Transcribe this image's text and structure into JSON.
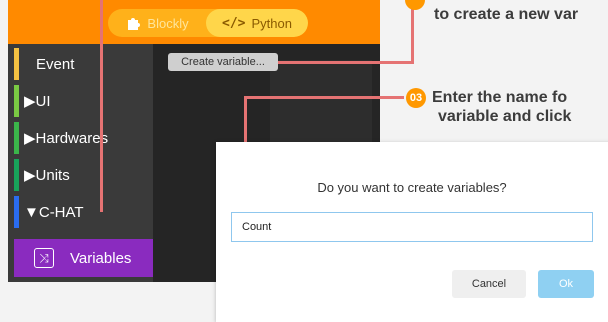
{
  "toggle": {
    "blockly_label": "Blockly",
    "python_label": "Python",
    "code_icon": "</>"
  },
  "categories": [
    {
      "label": "Event",
      "color": "#f5c242",
      "arrow": ""
    },
    {
      "label": "UI",
      "color": "#7ac943",
      "arrow": "▶ "
    },
    {
      "label": "Hardwares",
      "color": "#3bb54a",
      "arrow": "▶ "
    },
    {
      "label": "Units",
      "color": "#18a35a",
      "arrow": "▶ "
    },
    {
      "label": "C-HAT",
      "color": "#2a6cf0",
      "arrow": "▼ "
    }
  ],
  "variables_category": {
    "label": "Variables",
    "icon": "variables-icon",
    "color": "#8a2bbf"
  },
  "workspace": {
    "create_variable_button": "Create variable..."
  },
  "callouts": {
    "step2_tail": "to create a new var",
    "step3_number": "03",
    "step3_line1": "Enter the name fo",
    "step3_line2": "variable and click"
  },
  "dialog": {
    "question": "Do you want to create variables?",
    "input_value": "Count",
    "cancel_label": "Cancel",
    "ok_label": "Ok"
  },
  "colors": {
    "accent_orange": "#ff8a00",
    "guide_line": "#e57373",
    "variables_purple": "#8a2bbf"
  }
}
